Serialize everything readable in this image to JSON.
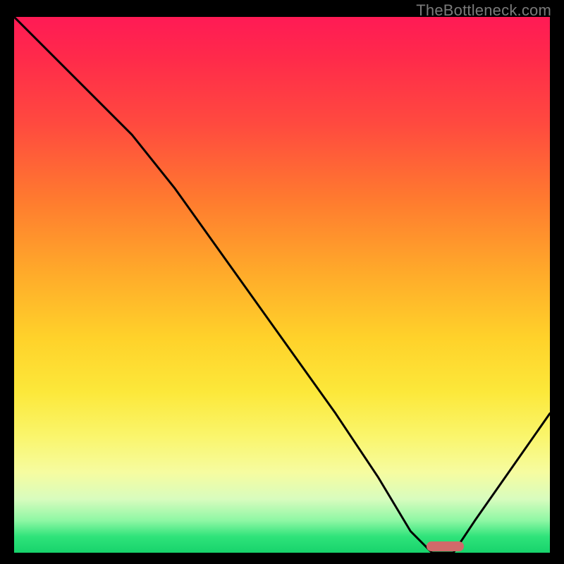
{
  "watermark": "TheBottleneck.com",
  "chart_data": {
    "type": "line",
    "title": "",
    "xlabel": "",
    "ylabel": "",
    "xlim": [
      0,
      100
    ],
    "ylim": [
      0,
      100
    ],
    "grid": false,
    "series": [
      {
        "name": "curve",
        "x": [
          0,
          22,
          30,
          40,
          50,
          60,
          68,
          74,
          78,
          82,
          86,
          100
        ],
        "values": [
          100,
          78,
          68,
          54,
          40,
          26,
          14,
          4,
          0,
          0,
          6,
          26
        ]
      }
    ],
    "marker": {
      "x_start": 77,
      "x_end": 84,
      "y": 0,
      "color": "#d06a6a"
    },
    "gradient_stops": [
      {
        "pct": 0,
        "color": "#ff1a55"
      },
      {
        "pct": 40,
        "color": "#ff9a2a"
      },
      {
        "pct": 70,
        "color": "#fce83a"
      },
      {
        "pct": 92,
        "color": "#c8fbb0"
      },
      {
        "pct": 100,
        "color": "#17d36c"
      }
    ]
  }
}
